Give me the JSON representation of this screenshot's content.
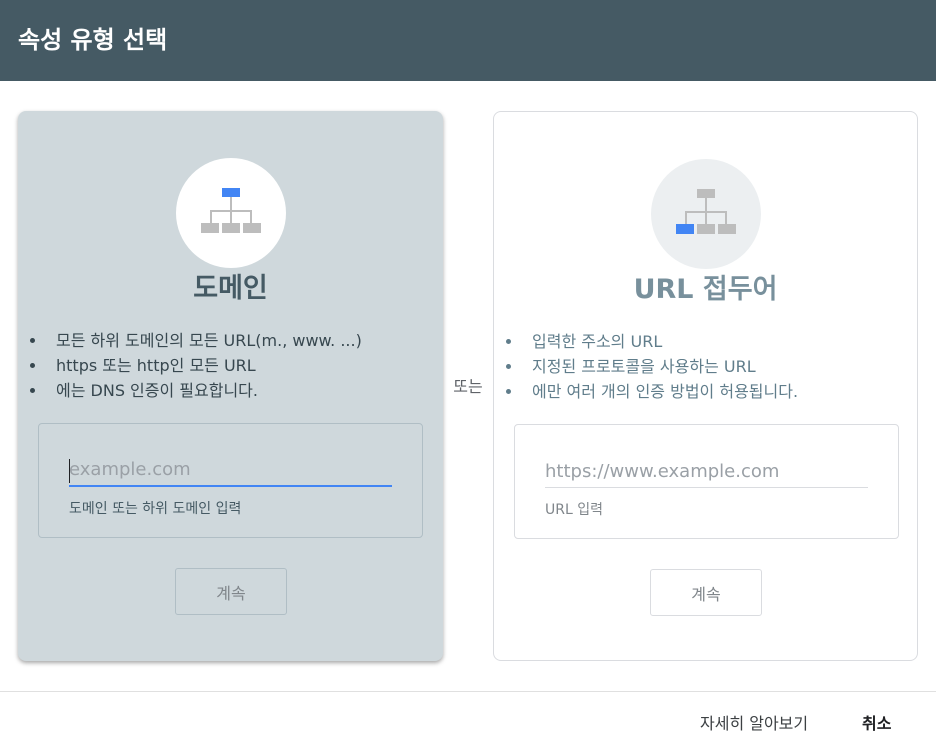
{
  "dialog": {
    "title": "속성 유형 선택"
  },
  "domain_card": {
    "title": "도메인",
    "bullets": [
      "모든 하위 도메인의 모든 URL(m., www. ...)",
      "https 또는 http인 모든 URL",
      "에는 DNS 인증이 필요합니다."
    ],
    "input_placeholder": "example.com",
    "input_value": "",
    "input_help": "도메인 또는 하위 도메인 입력",
    "continue_label": "계속",
    "colors": {
      "background": "#cfd8dc",
      "accent": "#4285f4"
    }
  },
  "separator": {
    "label": "또는"
  },
  "url_card": {
    "title": "URL 접두어",
    "bullets": [
      "입력한 주소의 URL",
      "지정된 프로토콜을 사용하는 URL",
      "에만 여러 개의 인증 방법이 허용됩니다."
    ],
    "input_placeholder": "https://www.example.com",
    "input_value": "",
    "input_help": "URL 입력",
    "continue_label": "계속",
    "colors": {
      "background": "#ffffff",
      "accent": "#4285f4"
    }
  },
  "footer": {
    "learn_more": "자세히 알아보기",
    "cancel": "취소"
  },
  "icons": {
    "domain": "sitemap-root-highlighted-icon",
    "url_prefix": "sitemap-leaf-highlighted-icon"
  },
  "colors": {
    "header": "#455a64",
    "highlight": "#4285f4",
    "tree_gray": "#bdbdbd"
  }
}
